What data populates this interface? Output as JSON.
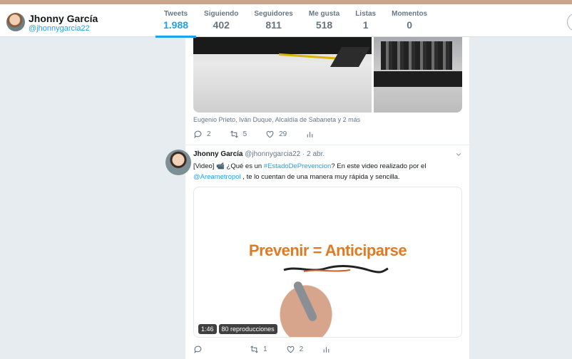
{
  "header": {
    "name": "Jhonny García",
    "handle": "@jhonnygarcia22",
    "stats": [
      {
        "label": "Tweets",
        "value": "1.988",
        "active": true
      },
      {
        "label": "Siguiendo",
        "value": "402"
      },
      {
        "label": "Seguidores",
        "value": "811"
      },
      {
        "label": "Me gusta",
        "value": "518"
      },
      {
        "label": "Listas",
        "value": "1"
      },
      {
        "label": "Momentos",
        "value": "0"
      }
    ]
  },
  "tweet1": {
    "caption": "Eugenio Prieto, Iván Duque, Alcaldía de Sabaneta y 2 más",
    "replies": "2",
    "retweets": "5",
    "likes": "29"
  },
  "tweet2": {
    "name": "Jhonny García",
    "handle": "@jhonnygarcia22 · 2 abr.",
    "text_prefix": "[Video] 📹 ¿Qué es un ",
    "hashtag": "#EstadoDePrevencion",
    "text_mid": "?  En este video realizado por el",
    "mention": "@Areametropol",
    "text_suffix": " , te lo cuentan de una manera muy rápida y sencilla.",
    "video_title": "Prevenir = Anticiparse",
    "duration": "1:46",
    "views": "80 reproducciones",
    "replies": "",
    "retweets": "1",
    "likes": "2"
  },
  "colors": {
    "accent": "#1da1f2",
    "background": "#e6ecf0",
    "video_title": "#e07b24"
  }
}
